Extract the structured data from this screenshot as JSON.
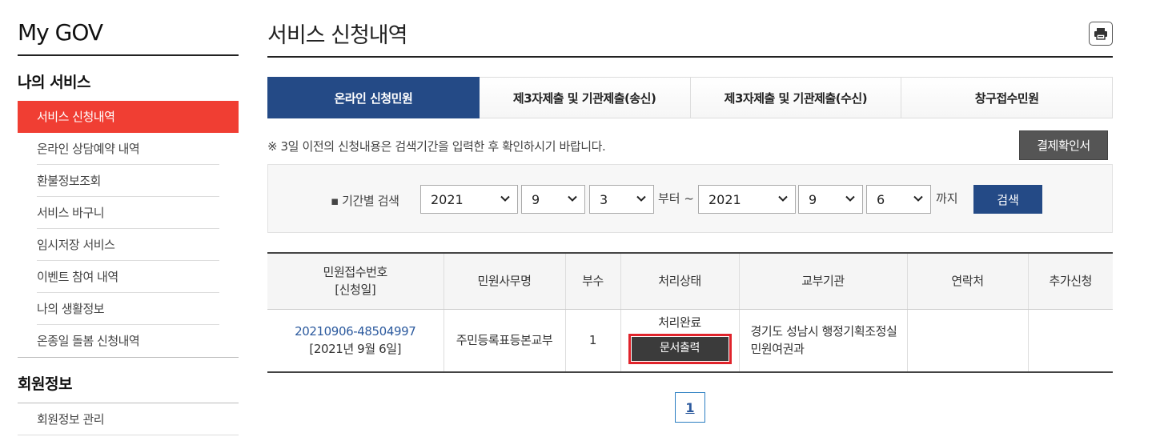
{
  "sidebar": {
    "brand": "My GOV",
    "services_title": "나의 서비스",
    "services": [
      {
        "label": "서비스 신청내역",
        "active": true
      },
      {
        "label": "온라인 상담예약 내역"
      },
      {
        "label": "환불정보조회"
      },
      {
        "label": "서비스 바구니"
      },
      {
        "label": "임시저장 서비스"
      },
      {
        "label": "이벤트 참여 내역"
      },
      {
        "label": "나의 생활정보"
      },
      {
        "label": "온종일 돌봄 신청내역"
      }
    ],
    "member_title": "회원정보",
    "member_items": [
      {
        "label": "회원정보 관리"
      }
    ]
  },
  "header": {
    "title": "서비스 신청내역",
    "print_icon": "printer-icon"
  },
  "tabs": [
    {
      "label": "온라인 신청민원",
      "active": true
    },
    {
      "label": "제3자제출 및 기관제출(송신)"
    },
    {
      "label": "제3자제출 및 기관제출(수신)"
    },
    {
      "label": "창구접수민원"
    }
  ],
  "notice": "※ 3일 이전의 신청내용은 검색기간을 입력한 후 확인하시기 바랍니다.",
  "payment_button": "결제확인서",
  "search": {
    "label": "▪ 기간별 검색",
    "from_year": "2021",
    "from_month": "9",
    "from_day": "3",
    "from_text": "부터 ~",
    "to_year": "2021",
    "to_month": "9",
    "to_day": "6",
    "to_text": "까지",
    "button": "검색"
  },
  "table": {
    "headers": {
      "receipt_no": "민원접수번호",
      "receipt_date": "[신청일]",
      "service_name": "민원사무명",
      "copies": "부수",
      "status": "처리상태",
      "agency": "교부기관",
      "contact": "연락처",
      "extra": "추가신청"
    },
    "rows": [
      {
        "receipt_no": "20210906-48504997",
        "receipt_date": "[2021년 9월 6일]",
        "service_name": "주민등록표등본교부",
        "copies": "1",
        "status": "처리완료",
        "print_button": "문서출력",
        "agency_line1": "경기도 성남시 행정기획조정실",
        "agency_line2": "민원여권과",
        "contact": "",
        "extra": ""
      }
    ]
  },
  "pagination": {
    "current": "1"
  },
  "colors": {
    "accent_red": "#f03e33",
    "primary_navy": "#244a86",
    "highlight_red": "#e0232b"
  }
}
